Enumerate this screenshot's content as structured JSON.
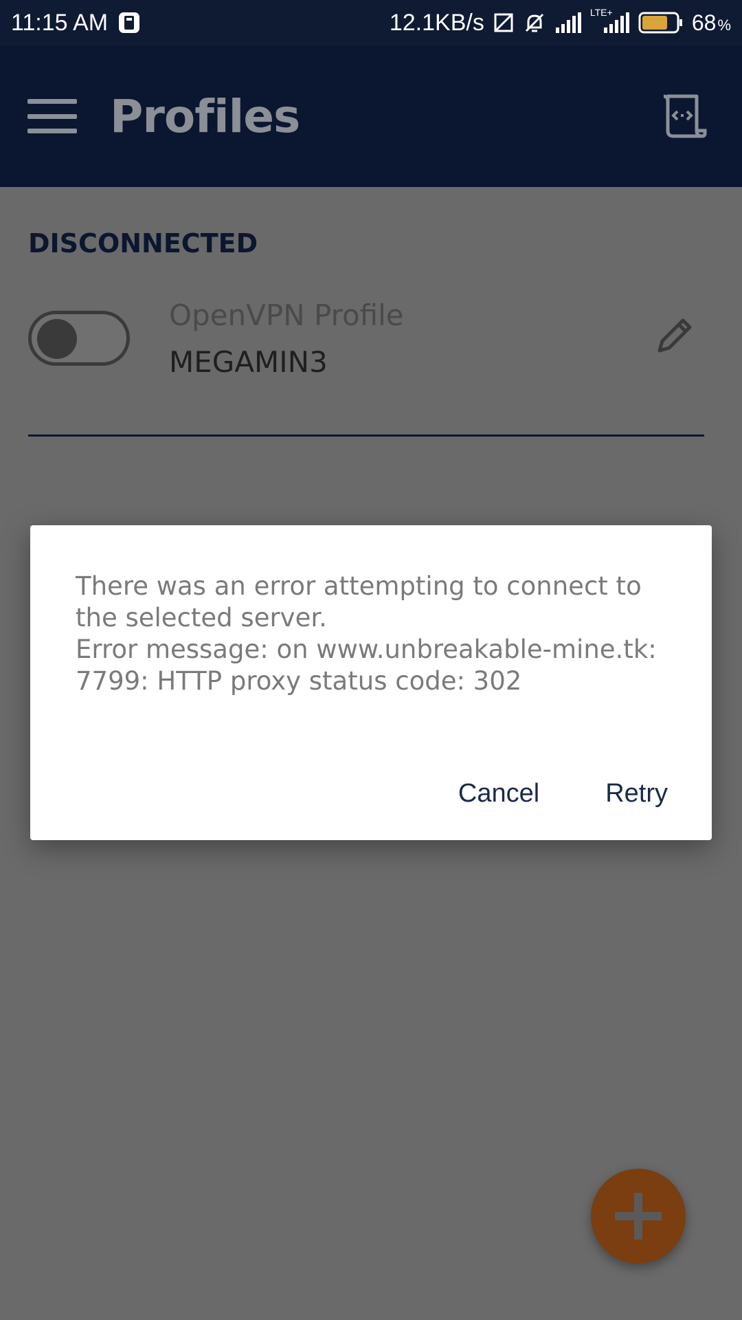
{
  "status_bar": {
    "time": "11:15 AM",
    "net_speed": "12.1KB/s",
    "network_type": "LTE+",
    "battery_percent": "68",
    "battery_unit": "%"
  },
  "app_bar": {
    "title": "Profiles"
  },
  "section": {
    "header": "DISCONNECTED"
  },
  "profile": {
    "type": "OpenVPN Profile",
    "name": "MEGAMIN3",
    "connected": false
  },
  "dialog": {
    "message": "There was an error attempting to connect to\nthe selected server.\nError message: on www.unbreakable-mine.tk:\n7799: HTTP proxy status code: 302",
    "cancel_label": "Cancel",
    "retry_label": "Retry"
  },
  "colors": {
    "app_bar": "#0b1630",
    "fab": "#7a3e10",
    "scrim": "#6a6a6a"
  }
}
